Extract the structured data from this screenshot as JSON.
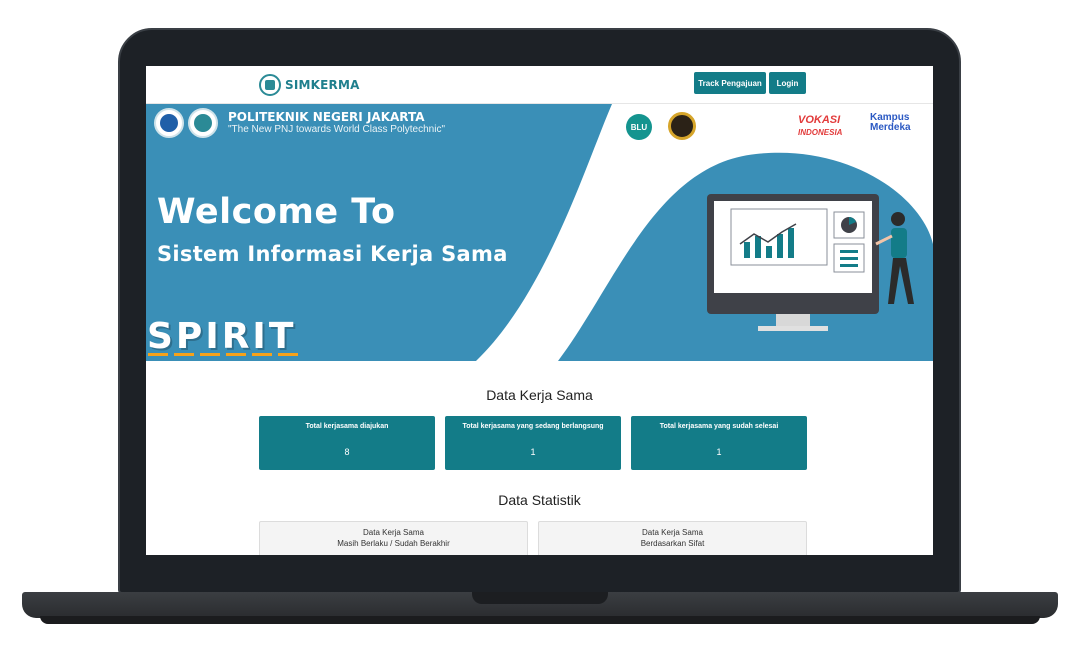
{
  "navbar": {
    "brand": "SIMKERMA",
    "track_label": "Track Pengajuan",
    "login_label": "Login"
  },
  "hero": {
    "institution": "POLITEKNIK NEGERI JAKARTA",
    "tagline": "\"The New  PNJ towards World Class Polytechnic\"",
    "welcome": "Welcome To",
    "system_name": "Sistem Informasi Kerja Sama",
    "spirit": "SPIRIT",
    "badge_blu": "BLU",
    "logo_vokasi": "VOKASI",
    "logo_vokasi_sub": "INDONESIA",
    "logo_kampus": "Kampus",
    "logo_merdeka": "Merdeka"
  },
  "data_kerja_sama": {
    "title": "Data Kerja Sama",
    "cards": [
      {
        "label": "Total kerjasama diajukan",
        "value": "8"
      },
      {
        "label": "Total kerjasama yang sedang berlangsung",
        "value": "1"
      },
      {
        "label": "Total kerjasama yang sudah selesai",
        "value": "1"
      }
    ]
  },
  "data_statistik": {
    "title": "Data Statistik",
    "panels": [
      {
        "title": "Data Kerja Sama",
        "subtitle": "Masih Berlaku / Sudah Berakhir"
      },
      {
        "title": "Data Kerja Sama",
        "subtitle": "Berdasarkan Sifat"
      }
    ]
  },
  "colors": {
    "teal": "#137c88",
    "hero_blue": "#3a8fb7"
  }
}
